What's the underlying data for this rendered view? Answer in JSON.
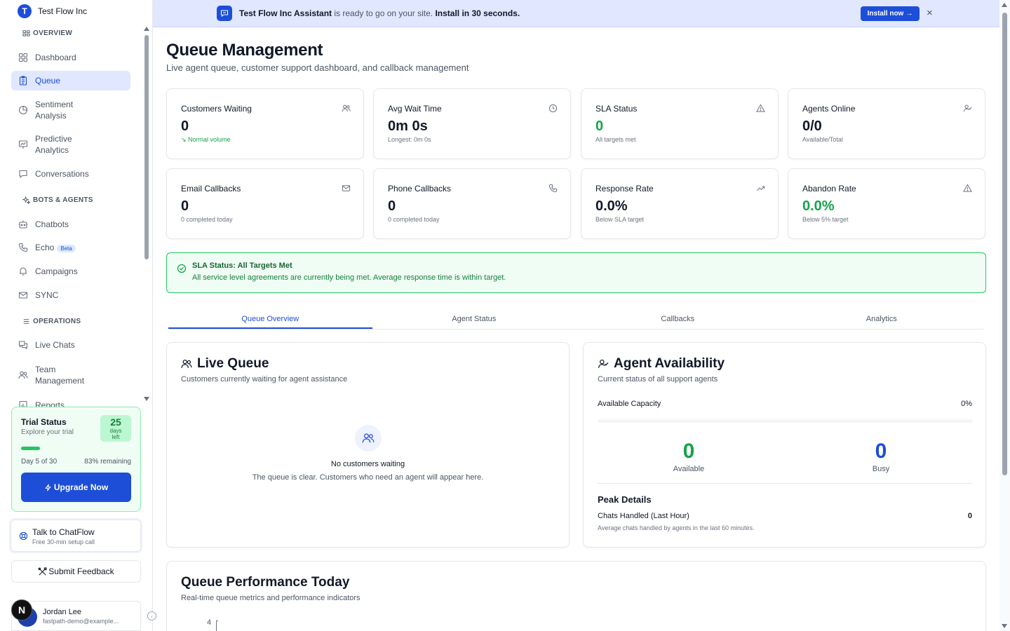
{
  "org": {
    "initial": "T",
    "name": "Test Flow Inc"
  },
  "sidebar": {
    "overview_label": "OVERVIEW",
    "bots_label": "BOTS & AGENTS",
    "operations_label": "OPERATIONS",
    "items": {
      "dashboard": "Dashboard",
      "queue": "Queue",
      "sentiment_1": "Sentiment",
      "sentiment_2": "Analysis",
      "predictive_1": "Predictive",
      "predictive_2": "Analytics",
      "conversations": "Conversations",
      "chatbots": "Chatbots",
      "echo": "Echo",
      "echo_badge": "Beta",
      "campaigns": "Campaigns",
      "sync": "SYNC",
      "live_chats": "Live Chats",
      "team_1": "Team",
      "team_2": "Management",
      "reports": "Reports"
    },
    "trial": {
      "title": "Trial Status",
      "subtitle": "Explore your trial",
      "days": "25",
      "days_label_1": "days",
      "days_label_2": "left",
      "progress": 0.17,
      "day_text": "Day 5 of 30",
      "remaining": "83% remaining",
      "upgrade_label": "Upgrade Now"
    },
    "talk": {
      "title": "Talk to ChatFlow",
      "subtitle": "Free 30-min setup call"
    },
    "feedback_label": "Submit Feedback",
    "user": {
      "name": "Jordan Lee",
      "email": "fastpath-demo@example...",
      "badge": "N"
    }
  },
  "banner": {
    "brand": "Test Flow Inc Assistant",
    "text": " is ready to go on your site. ",
    "emphasis": "Install in 30 seconds.",
    "button": "Install now",
    "close": "×"
  },
  "page": {
    "title": "Queue Management",
    "subtitle": "Live agent queue, customer support dashboard, and callback management"
  },
  "stats": [
    {
      "label": "Customers Waiting",
      "value": "0",
      "note": "Normal volume",
      "icon": "users-icon"
    },
    {
      "label": "Avg Wait Time",
      "value": "0m 0s",
      "note": "Longest: 0m 0s",
      "icon": "clock-icon"
    },
    {
      "label": "SLA Status",
      "value": "0",
      "note": "All targets met",
      "icon": "warning-icon"
    },
    {
      "label": "Agents Online",
      "value": "0/0",
      "note": "Available/Total",
      "icon": "user-check-icon"
    },
    {
      "label": "Email Callbacks",
      "value": "0",
      "note": "0 completed today",
      "icon": "mail-icon"
    },
    {
      "label": "Phone Callbacks",
      "value": "0",
      "note": "0 completed today",
      "icon": "phone-icon"
    },
    {
      "label": "Response Rate",
      "value": "0.0%",
      "note": "Below SLA target",
      "icon": "trending-up-icon"
    },
    {
      "label": "Abandon Rate",
      "value": "0.0%",
      "note": "Below 5% target",
      "icon": "warning-icon"
    }
  ],
  "sla_alert": {
    "title": "SLA Status: All Targets Met",
    "text": "All service level agreements are currently being met. Average response time is within target."
  },
  "tabs": [
    "Queue Overview",
    "Agent Status",
    "Callbacks",
    "Analytics"
  ],
  "live_queue": {
    "title": "Live Queue",
    "subtitle": "Customers currently waiting for agent assistance",
    "empty_title": "No customers waiting",
    "empty_text": "The queue is clear. Customers who need an agent will appear here."
  },
  "availability": {
    "title": "Agent Availability",
    "subtitle": "Current status of all support agents",
    "capacity_label": "Available Capacity",
    "capacity_value": "0%",
    "capacity_fraction": 0,
    "available_num": "0",
    "available_label": "Available",
    "busy_num": "0",
    "busy_label": "Busy",
    "peak_title": "Peak Details",
    "peak_row": "Chats Handled (Last Hour)",
    "peak_value": "0",
    "peak_desc": "Average chats handled by agents in the last 60 minutes."
  },
  "performance": {
    "title": "Queue Performance Today",
    "subtitle": "Real-time queue metrics and performance indicators",
    "first_tick": "4"
  },
  "colors": {
    "accent": "#1d4ed8",
    "success": "#16a34a",
    "trial_border": "#86efac"
  }
}
